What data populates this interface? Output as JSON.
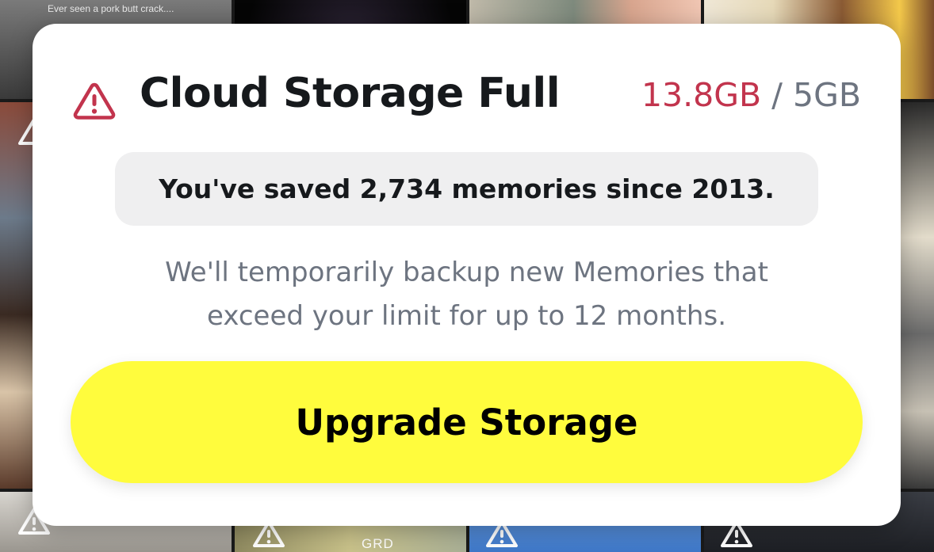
{
  "background": {
    "top_left_caption": "Ever seen a pork butt crack....",
    "bottom_tile_text": "GRD"
  },
  "modal": {
    "icon": "warning-triangle-icon",
    "title": "Cloud Storage Full",
    "usage": {
      "used": "13.8GB",
      "separator": " / ",
      "limit": "5GB",
      "used_color": "#c2344d",
      "limit_color": "#6d7480"
    },
    "memories_notice": "You've saved 2,734 memories since 2013.",
    "description_lines": [
      "We'll temporarily backup new Memories that",
      "exceed your limit for up to 12 months."
    ],
    "upgrade_button_label": "Upgrade Storage",
    "button_color": "#fffc3d",
    "warning_color": "#c2344d"
  }
}
